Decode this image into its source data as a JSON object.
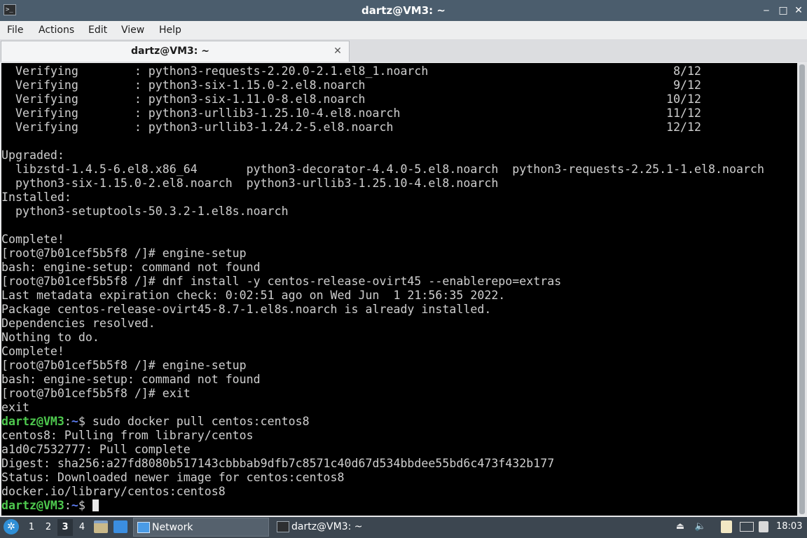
{
  "window": {
    "title": "dartz@VM3: ~",
    "app_icon_glyph": ">_",
    "minimize_glyph": "‒",
    "maximize_glyph": "□",
    "close_glyph": "✕"
  },
  "menubar": {
    "items": [
      "File",
      "Actions",
      "Edit",
      "View",
      "Help"
    ]
  },
  "tabs": [
    {
      "label": "dartz@VM3: ~",
      "close_glyph": "✕"
    }
  ],
  "terminal": {
    "lines": [
      "  Verifying        : python3-requests-2.20.0-2.1.el8_1.noarch                                   8/12",
      "  Verifying        : python3-six-1.15.0-2.el8.noarch                                            9/12",
      "  Verifying        : python3-six-1.11.0-8.el8.noarch                                           10/12",
      "  Verifying        : python3-urllib3-1.25.10-4.el8.noarch                                      11/12",
      "  Verifying        : python3-urllib3-1.24.2-5.el8.noarch                                       12/12",
      "",
      "Upgraded:",
      "  libzstd-1.4.5-6.el8.x86_64       python3-decorator-4.4.0-5.el8.noarch  python3-requests-2.25.1-1.el8.noarch",
      "  python3-six-1.15.0-2.el8.noarch  python3-urllib3-1.25.10-4.el8.noarch",
      "Installed:",
      "  python3-setuptools-50.3.2-1.el8s.noarch",
      "",
      "Complete!",
      "[root@7b01cef5b5f8 /]# engine-setup",
      "bash: engine-setup: command not found",
      "[root@7b01cef5b5f8 /]# dnf install -y centos-release-ovirt45 --enablerepo=extras",
      "Last metadata expiration check: 0:02:51 ago on Wed Jun  1 21:56:35 2022.",
      "Package centos-release-ovirt45-8.7-1.el8s.noarch is already installed.",
      "Dependencies resolved.",
      "Nothing to do.",
      "Complete!",
      "[root@7b01cef5b5f8 /]# engine-setup",
      "bash: engine-setup: command not found",
      "[root@7b01cef5b5f8 /]# exit",
      "exit"
    ],
    "prompt_user": "dartz@VM3",
    "prompt_sep": ":",
    "prompt_path": "~",
    "prompt_symbol": "$ ",
    "docker_command": "sudo docker pull centos:centos8",
    "docker_output": [
      "centos8: Pulling from library/centos",
      "a1d0c7532777: Pull complete",
      "Digest: sha256:a27fd8080b517143cbbbab9dfb7c8571c40d67d534bbdee55bd6c473f432b177",
      "Status: Downloaded newer image for centos:centos8",
      "docker.io/library/centos:centos8"
    ],
    "colors": {
      "background": "#000000",
      "foreground": "#cfcfcf",
      "prompt_user": "#4ec94e",
      "prompt_path": "#5c7cf0"
    }
  },
  "taskbar": {
    "start_icon": "lxqt-start-icon",
    "start_glyph": "✲",
    "workspaces": [
      "1",
      "2",
      "3",
      "4"
    ],
    "active_workspace": "3",
    "tasks": [
      {
        "label": "Network",
        "icon": "folder-icon"
      },
      {
        "label": "dartz@VM3: ~",
        "icon": "terminal-icon"
      }
    ],
    "tray": {
      "eject_glyph": "⏏",
      "volume_glyph": "🔈"
    },
    "clock": "18:03"
  }
}
